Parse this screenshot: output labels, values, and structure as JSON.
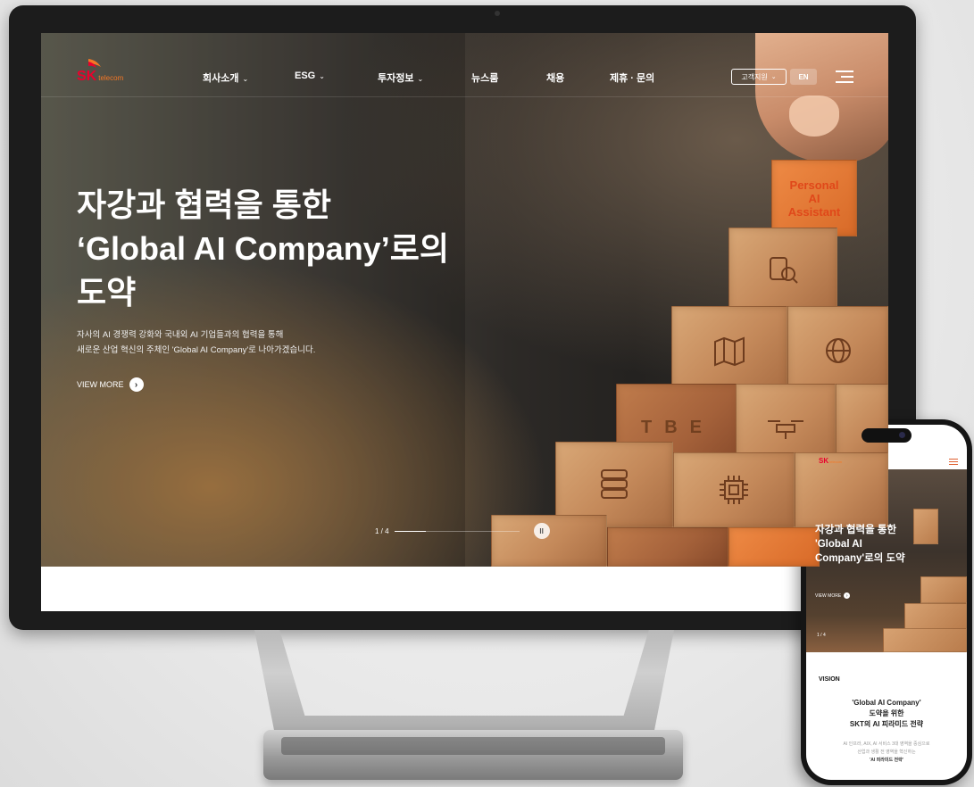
{
  "desktop": {
    "logo": {
      "brand": "SK",
      "sub": "telecom"
    },
    "nav": [
      {
        "label": "회사소개",
        "dropdown": true
      },
      {
        "label": "ESG",
        "dropdown": true
      },
      {
        "label": "투자정보",
        "dropdown": true
      },
      {
        "label": "뉴스룸",
        "dropdown": false
      },
      {
        "label": "채용",
        "dropdown": false
      },
      {
        "label": "제휴 · 문의",
        "dropdown": false
      }
    ],
    "customer_support": "고객지원",
    "lang": "EN",
    "hero": {
      "title_line1": "자강과 협력을 통한",
      "title_line2": "‘Global AI Company’로의",
      "title_line3": "도약",
      "desc_line1": "자사의 AI 경쟁력 강화와 국내외 AI 기업들과의 협력을 통해",
      "desc_line2": "새로운 산업 혁신의 주체인 'Global AI Company'로 나아가겠습니다.",
      "view_more": "VIEW MORE",
      "pager": "1 / 4",
      "pager_progress": 0.25,
      "block_personal": "Personal",
      "block_ai": "AI",
      "block_assistant": "Assistant",
      "block_tbe": "TBE"
    }
  },
  "mobile": {
    "logo": {
      "brand": "SK",
      "sub": "telecom"
    },
    "hero": {
      "title_line1": "자강과 협력을 통한",
      "title_line2": "'Global AI",
      "title_line3": "Company'로의 도약",
      "view_more": "VIEW MORE",
      "pager": "1 / 4"
    },
    "vision": {
      "label": "VISION",
      "title_line1": "'Global AI Company'",
      "title_line2": "도약을 위한",
      "title_line3": "SKT의 AI 피라미드 전략",
      "desc_line1": "AI 인프라, AIX, AI 서비스 3대 영역을 중심으로",
      "desc_line2": "산업과 생활 전 영역을 혁신하는",
      "link": "'AI 피라미드 전략'"
    }
  },
  "colors": {
    "brand_red": "#ea002c",
    "brand_orange": "#f47725"
  }
}
